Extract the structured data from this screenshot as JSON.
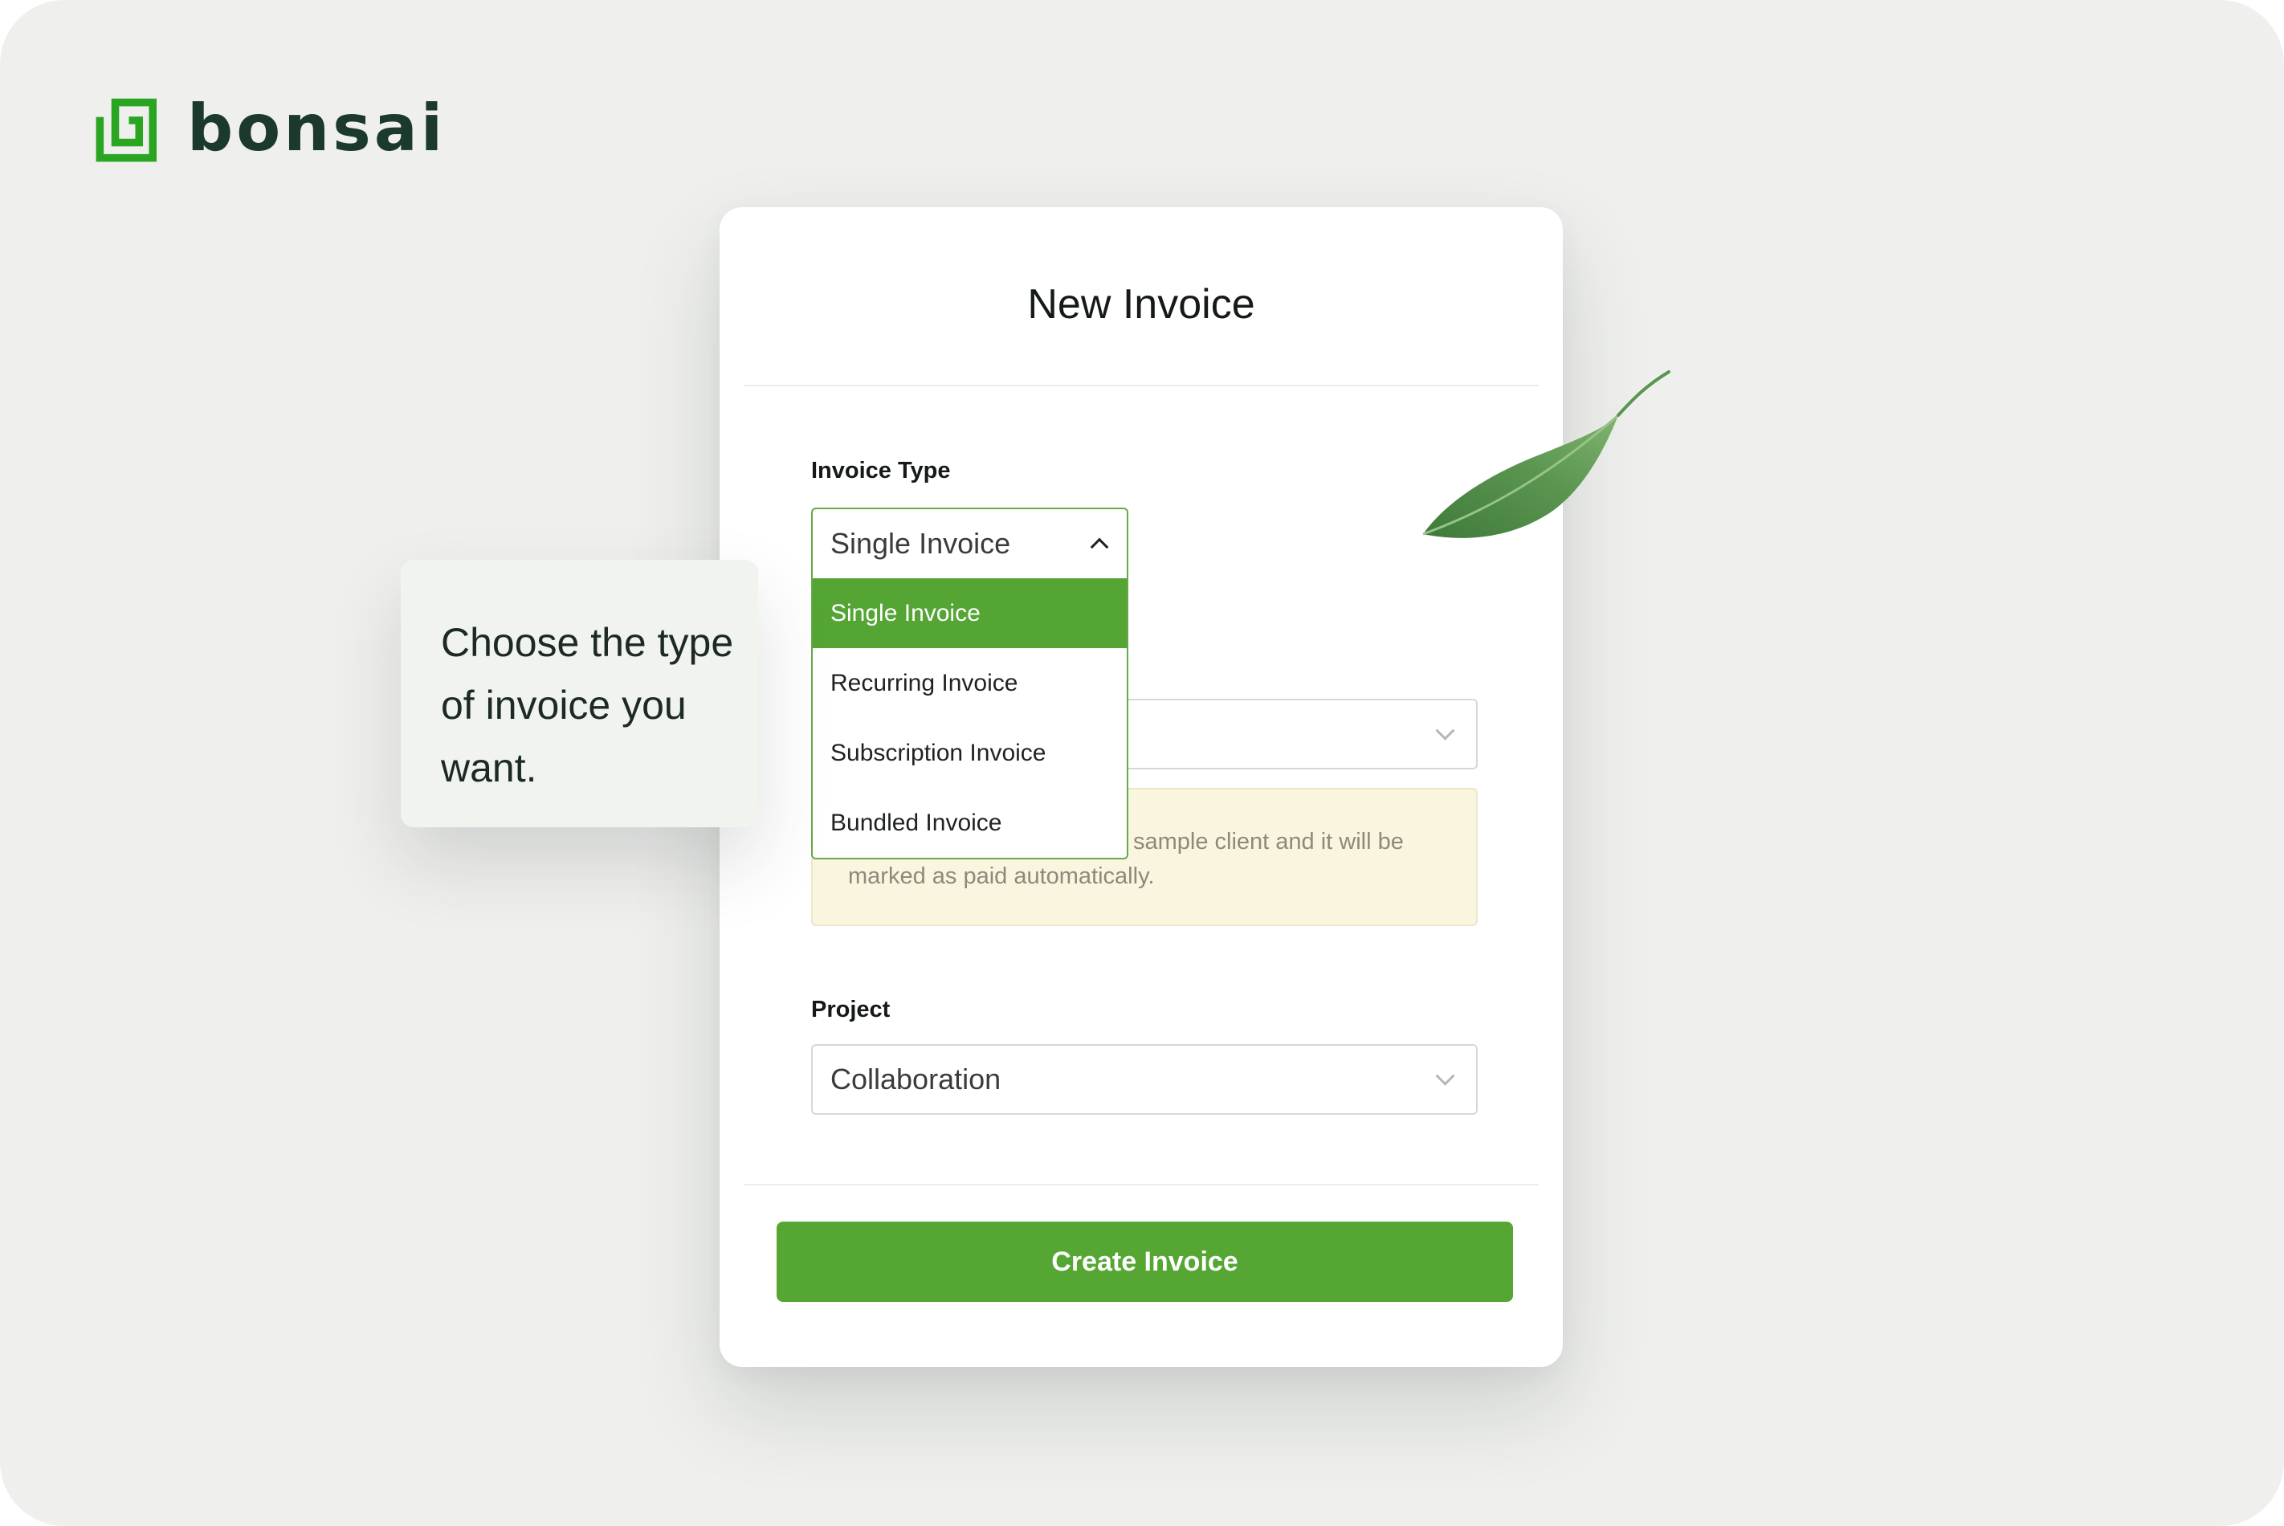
{
  "brand": {
    "name": "bonsai",
    "icon": "bonsai-logo-icon",
    "color": "#2aa521"
  },
  "invoice_form": {
    "title": "New Invoice",
    "invoice_type": {
      "label": "Invoice Type",
      "selected_value": "Single Invoice",
      "dropdown_open": true,
      "options": [
        "Single Invoice",
        "Recurring Invoice",
        "Subscription Invoice",
        "Bundled Invoice"
      ],
      "highlighted_option": "Single Invoice"
    },
    "notice": {
      "visible_text": "sample client and it will be marked as paid automatically."
    },
    "project": {
      "label": "Project",
      "selected_value": "Collaboration"
    },
    "submit_label": "Create Invoice"
  },
  "tooltip": {
    "text": "Choose the type of invoice you want."
  },
  "colors": {
    "accent_green": "#56a634",
    "background": "#eff0ee",
    "notice_background": "#f9f5df",
    "text_dark": "#141a17"
  }
}
